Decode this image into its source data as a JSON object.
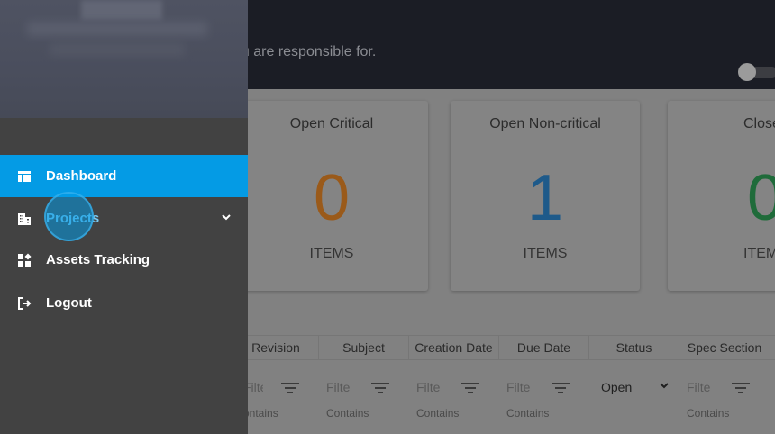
{
  "header": {
    "subtitle": "ou are responsible for."
  },
  "cards": [
    {
      "title": "Open Critical",
      "count": "0",
      "unit": "ITEMS",
      "color": "#9a5a1a"
    },
    {
      "title": "Open Non-critical",
      "count": "1",
      "unit": "ITEMS",
      "color": "#1e5a8a"
    },
    {
      "title": "Close",
      "count": "0",
      "unit": "ITEM",
      "color": "#1f6b3a"
    }
  ],
  "table": {
    "columns": [
      "Revision",
      "Subject",
      "Creation Date",
      "Due Date",
      "Status",
      "Spec Section"
    ],
    "filters": [
      {
        "placeholder": "Filte",
        "mode": "ontains"
      },
      {
        "placeholder": "Filte",
        "mode": "Contains"
      },
      {
        "placeholder": "Filte",
        "mode": "Contains"
      },
      {
        "placeholder": "Filte",
        "mode": "Contains"
      },
      {
        "placeholder": "Filte",
        "mode": "Contains"
      }
    ],
    "status_filter": "Open"
  },
  "drawer": {
    "items": [
      {
        "label": "Dashboard",
        "icon": "dashboard-icon",
        "active": true
      },
      {
        "label": "Projects",
        "icon": "building-icon",
        "expandable": true
      },
      {
        "label": "Assets Tracking",
        "icon": "widgets-icon"
      },
      {
        "label": "Logout",
        "icon": "logout-icon"
      }
    ]
  },
  "colors": {
    "accent": "#049be5",
    "drawer_bg": "#424242",
    "header_bg": "#1b1d25"
  }
}
